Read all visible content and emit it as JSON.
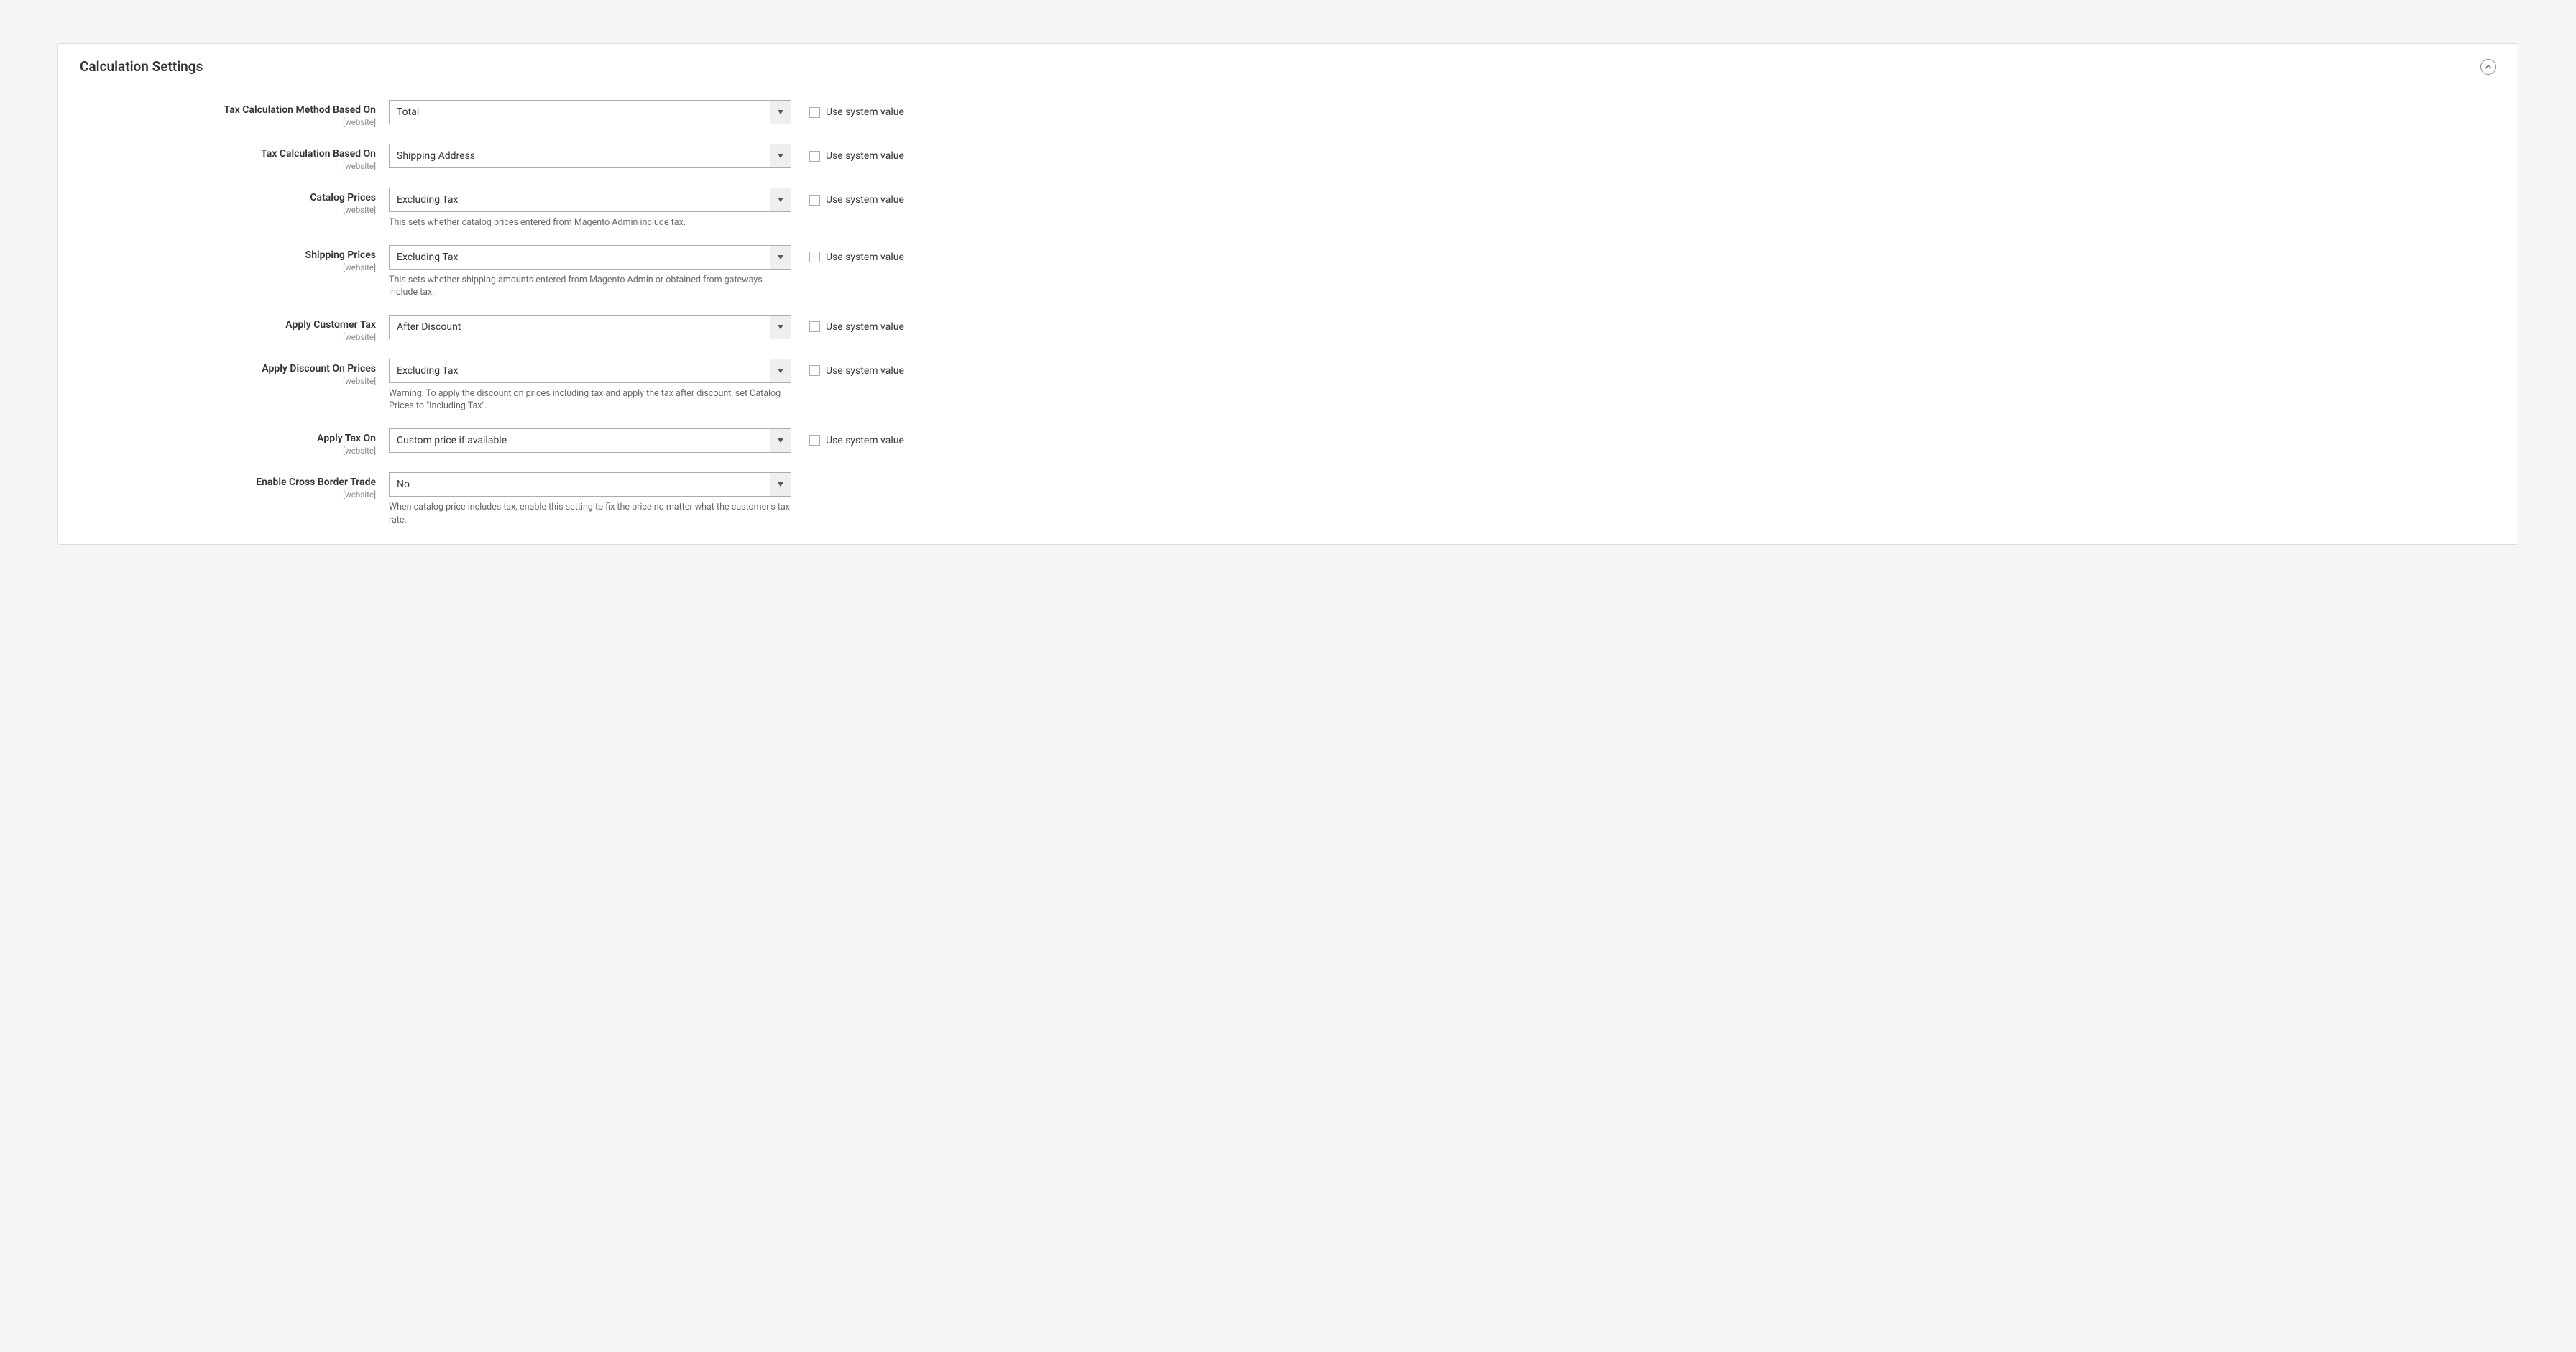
{
  "section": {
    "title": "Calculation Settings"
  },
  "scope_label": "[website]",
  "use_system_value_label": "Use system value",
  "fields": {
    "tax_calc_method": {
      "label": "Tax Calculation Method Based On",
      "value": "Total",
      "note": "",
      "show_sysval": true
    },
    "tax_calc_based_on": {
      "label": "Tax Calculation Based On",
      "value": "Shipping Address",
      "note": "",
      "show_sysval": true
    },
    "catalog_prices": {
      "label": "Catalog Prices",
      "value": "Excluding Tax",
      "note": "This sets whether catalog prices entered from Magento Admin include tax.",
      "show_sysval": true
    },
    "shipping_prices": {
      "label": "Shipping Prices",
      "value": "Excluding Tax",
      "note": "This sets whether shipping amounts entered from Magento Admin or obtained from gateways include tax.",
      "show_sysval": true
    },
    "apply_customer_tax": {
      "label": "Apply Customer Tax",
      "value": "After Discount",
      "note": "",
      "show_sysval": true
    },
    "apply_discount_on_prices": {
      "label": "Apply Discount On Prices",
      "value": "Excluding Tax",
      "note": "Warning: To apply the discount on prices including tax and apply the tax after discount, set Catalog Prices to \"Including Tax\".",
      "show_sysval": true
    },
    "apply_tax_on": {
      "label": "Apply Tax On",
      "value": "Custom price if available",
      "note": "",
      "show_sysval": true
    },
    "enable_cross_border": {
      "label": "Enable Cross Border Trade",
      "value": "No",
      "note": "When catalog price includes tax, enable this setting to fix the price no matter what the customer's tax rate.",
      "show_sysval": false
    }
  }
}
